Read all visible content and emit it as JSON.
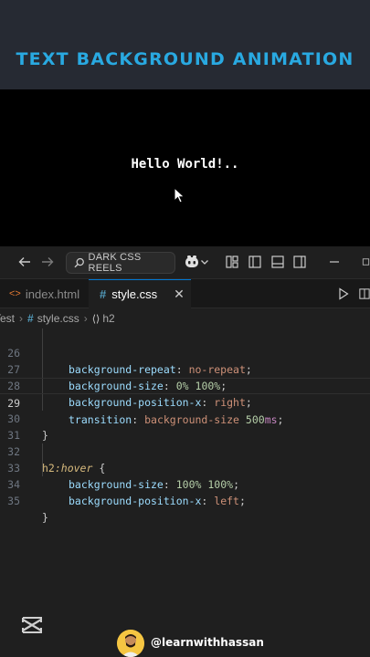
{
  "video": {
    "title": "TEXT BACKGROUND ANIMATION",
    "preview_text": "Hello World!..",
    "handle": "@learnwithhassan"
  },
  "titlebar": {
    "search_label": "DARK CSS REELS"
  },
  "tabs": [
    {
      "label": "index.html",
      "active": false
    },
    {
      "label": "style.css",
      "active": true
    }
  ],
  "breadcrumb": {
    "folder": "Test",
    "file": "style.css",
    "symbol": "h2"
  },
  "code": {
    "lines": [
      {
        "n": "26",
        "prop": "background-repeat",
        "value": "no-repeat"
      },
      {
        "n": "27",
        "prop": "background-size",
        "v1": "0%",
        "v2": "100%"
      },
      {
        "n": "28",
        "prop": "background-position-x",
        "value": "right"
      },
      {
        "n": "29",
        "prop": "transition",
        "value": "background-size",
        "num": "500",
        "unit": "ms"
      },
      {
        "n": "30",
        "text": "}"
      },
      {
        "n": "31",
        "text": ""
      },
      {
        "n": "32",
        "selector": "h2",
        "pseudo": ":hover",
        "brace": "{"
      },
      {
        "n": "33",
        "prop": "background-size",
        "v1": "100%",
        "v2": "100%"
      },
      {
        "n": "34",
        "prop": "background-position-x",
        "value": "left"
      },
      {
        "n": "35",
        "text": "}"
      }
    ],
    "current_line": "29"
  },
  "colors": {
    "title": "#29a9e1",
    "editor_bg": "#1f1f1f",
    "property": "#9cdcfe",
    "value": "#ce9178",
    "number": "#b5cea8"
  },
  "icons": [
    "back-arrow-icon",
    "forward-arrow-icon",
    "search-icon",
    "copilot-icon",
    "chevron-down-icon",
    "layout-icon",
    "toggle-sidebar-icon",
    "toggle-panel-icon",
    "toggle-secondary-sidebar-icon",
    "minimize-icon",
    "html-file-icon",
    "css-file-icon",
    "close-icon",
    "run-icon",
    "split-editor-icon",
    "capcut-logo-icon",
    "avatar"
  ]
}
